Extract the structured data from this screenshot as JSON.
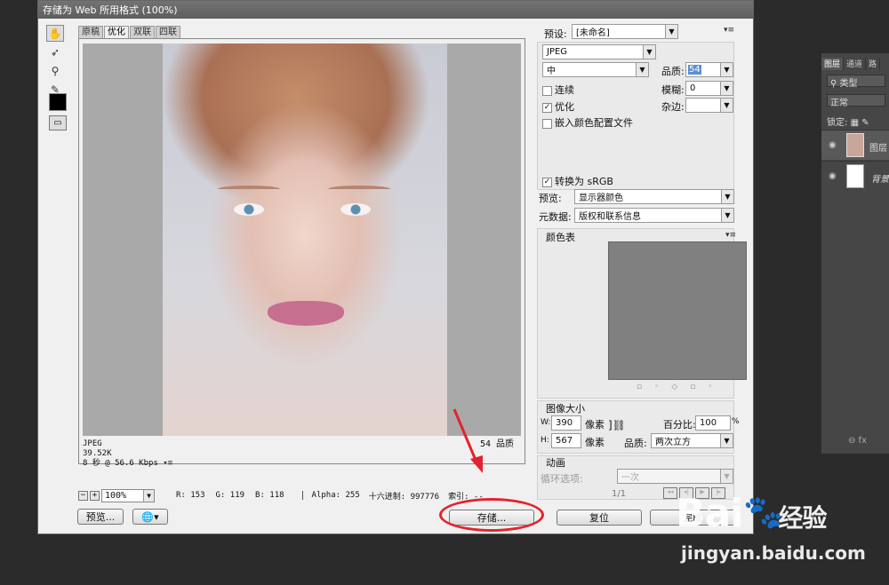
{
  "dialog": {
    "title": "存储为 Web 所用格式 (100%)"
  },
  "tabs": [
    "原稿",
    "优化",
    "双联",
    "四联"
  ],
  "preview": {
    "format": "JPEG",
    "size": "39.52K",
    "speed": "8 秒 @ 56.6 Kbps",
    "quality_text": "54 品质"
  },
  "statusbar": {
    "zoom": "100%",
    "r": "R: 153",
    "g": "G: 119",
    "b": "B: 118",
    "alpha": "Alpha: 255",
    "hex": "十六进制: 997776",
    "index": "索引: --"
  },
  "buttons": {
    "preview": "预览...",
    "save": "存储...",
    "reset": "复位",
    "done": "完成"
  },
  "settings": {
    "preset_label": "预设:",
    "preset_value": "[未命名]",
    "format": "JPEG",
    "quality_level": "中",
    "quality_label": "品质:",
    "quality_value": "54",
    "progressive": "连续",
    "blur_label": "模糊:",
    "blur_value": "0",
    "optimized": "优化",
    "matte_label": "杂边:",
    "embed_profile": "嵌入颜色配置文件",
    "convert_srgb": "转换为 sRGB",
    "preview_label": "预览:",
    "preview_value": "显示器颜色",
    "metadata_label": "元数据:",
    "metadata_value": "版权和联系信息",
    "color_table": "颜色表",
    "image_size": "图像大小",
    "w_label": "W:",
    "w_value": "390",
    "h_label": "H:",
    "h_value": "567",
    "px_unit": "像素",
    "percent_label": "百分比:",
    "percent_value": "100",
    "percent_sign": "%",
    "quality2_label": "品质:",
    "quality2_value": "两次立方",
    "animation": "动画",
    "loop_label": "循环选项:",
    "loop_value": "一次",
    "frame_counter": "1/1"
  },
  "ps_panel": {
    "tabs": [
      "图层",
      "通道",
      "路"
    ],
    "kind": "类型",
    "blend": "正常",
    "lock": "锁定:",
    "layer1": "图层",
    "layer2": "背景"
  },
  "watermark": {
    "logo": "Bai",
    "logo2": "经验",
    "url": "jingyan.baidu.com"
  },
  "colors": {
    "save_annotation": "#e3232c",
    "dialog_bg": "#f0f0f0",
    "ps_bg": "#2b2b2b"
  }
}
